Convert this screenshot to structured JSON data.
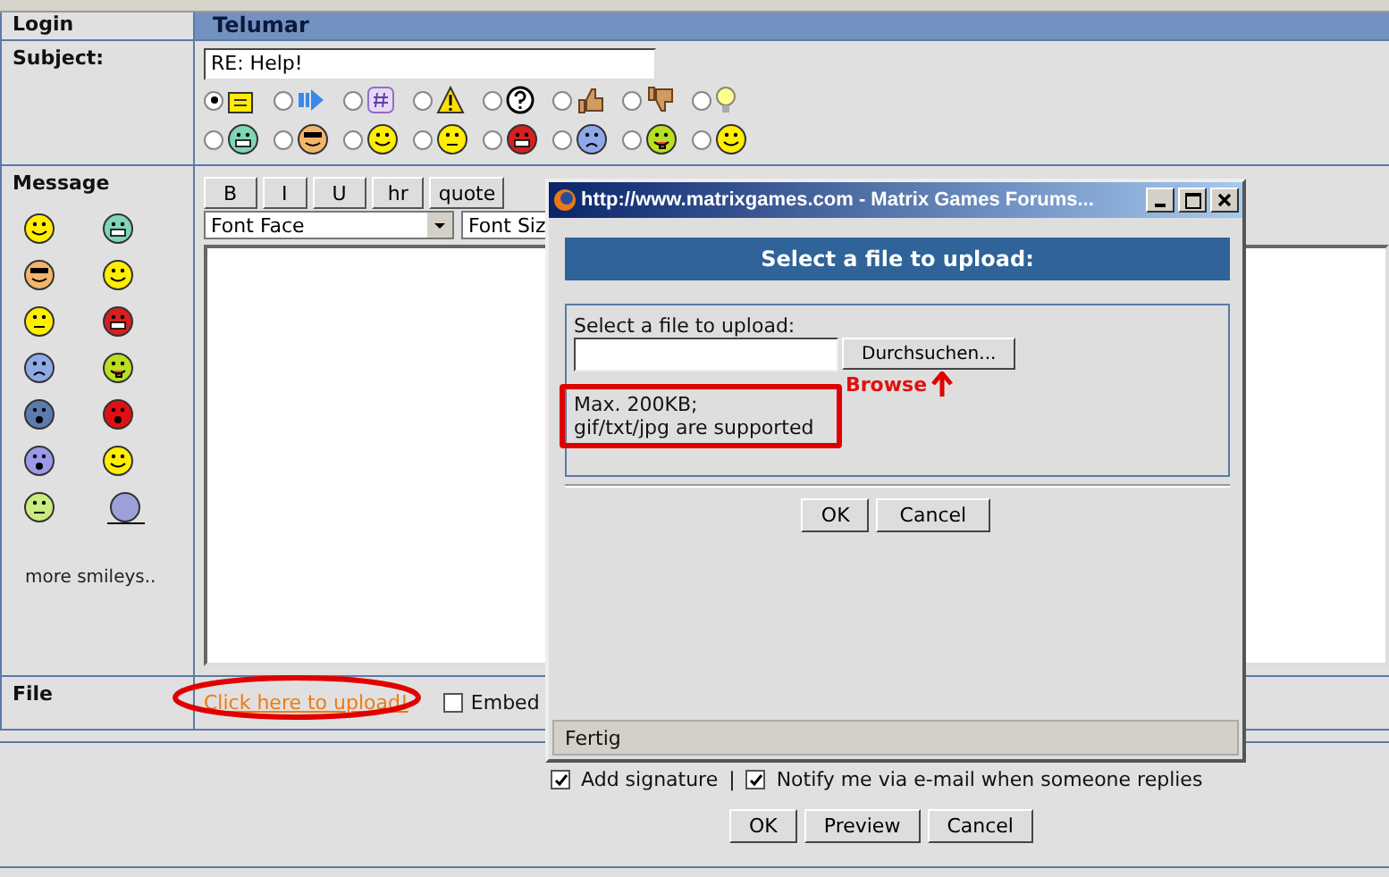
{
  "login": {
    "label": "Login",
    "value": "Telumar"
  },
  "subject": {
    "label": "Subject:",
    "value": "RE: Help!",
    "icon_rows": [
      {
        "icons": [
          {
            "kind": "note",
            "selected": true
          },
          {
            "kind": "arrow",
            "selected": false
          },
          {
            "kind": "hash",
            "selected": false
          },
          {
            "kind": "warning",
            "selected": false
          },
          {
            "kind": "question",
            "selected": false
          },
          {
            "kind": "thumbsup",
            "selected": false
          },
          {
            "kind": "thumbsdown",
            "selected": false
          },
          {
            "kind": "bulb",
            "selected": false
          }
        ]
      },
      {
        "icons": [
          {
            "kind": "grin",
            "selected": false
          },
          {
            "kind": "cool",
            "selected": false
          },
          {
            "kind": "smile",
            "selected": false
          },
          {
            "kind": "confused",
            "selected": false
          },
          {
            "kind": "angry",
            "selected": false
          },
          {
            "kind": "sad",
            "selected": false
          },
          {
            "kind": "tongue",
            "selected": false
          },
          {
            "kind": "smile",
            "selected": false
          }
        ]
      }
    ]
  },
  "message": {
    "label": "Message",
    "smileys": [
      {
        "kind": "smile"
      },
      {
        "kind": "grin"
      },
      {
        "kind": "cool"
      },
      {
        "kind": "smile"
      },
      {
        "kind": "confused"
      },
      {
        "kind": "angry"
      },
      {
        "kind": "sad"
      },
      {
        "kind": "tongue"
      },
      {
        "kind": "sleep"
      },
      {
        "kind": "shocked"
      },
      {
        "kind": "eek"
      },
      {
        "kind": "evil"
      },
      {
        "kind": "roll"
      },
      {
        "kind": "blob"
      }
    ],
    "more_link": "more smileys..",
    "toolbar": [
      "B",
      "I",
      "U",
      "hr",
      "quote"
    ],
    "font_face": "Font Face",
    "font_size": "Font Siz"
  },
  "file": {
    "label": "File",
    "upload_link": "Click here to upload!",
    "embed": {
      "label": "Embed",
      "checked": false
    }
  },
  "options": [
    {
      "label": "Add signature",
      "checked": true
    },
    {
      "label": "Notify me via e-mail when someone replies",
      "checked": true
    }
  ],
  "options_separator": "|",
  "buttons": [
    "OK",
    "Preview",
    "Cancel"
  ],
  "popup": {
    "title": "http://www.matrixgames.com - Matrix Games Forums...",
    "heading": "Select a file to upload:",
    "field_label": "Select a file to upload:",
    "browse_button": "Durchsuchen...",
    "annotation": "Browse",
    "limits": [
      "Max. 200KB;",
      "gif/txt/jpg are supported"
    ],
    "buttons": [
      "OK",
      "Cancel"
    ],
    "status": "Fertig"
  }
}
